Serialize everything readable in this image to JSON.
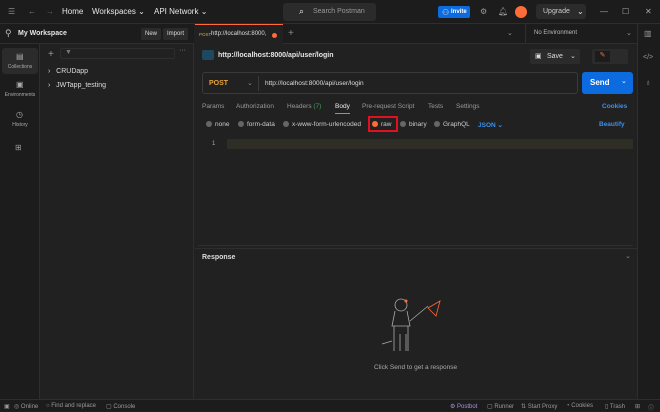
{
  "topbar": {
    "home": "Home",
    "workspaces": "Workspaces",
    "api_network": "API Network",
    "search_placeholder": "Search Postman",
    "invite": "Invite",
    "upgrade": "Upgrade"
  },
  "rail": [
    {
      "label": "Collections",
      "icon": "collections-icon"
    },
    {
      "label": "Environments",
      "icon": "environments-icon"
    },
    {
      "label": "History",
      "icon": "history-icon"
    }
  ],
  "sidebar": {
    "workspace": "My Workspace",
    "new": "New",
    "import": "Import",
    "collections": [
      "CRUDapp",
      "JWTapp_testing"
    ]
  },
  "tabs": {
    "method": "POST",
    "title": "http://localhost:8000,",
    "environment": "No Environment"
  },
  "request": {
    "title": "http://localhost:8000/api/user/login",
    "save": "Save",
    "method": "POST",
    "url": "http://localhost:8000/api/user/login",
    "send": "Send",
    "tabs": [
      "Params",
      "Authorization",
      "Headers",
      "Body",
      "Pre-request Script",
      "Tests",
      "Settings"
    ],
    "headers_count": "(7)",
    "cookies": "Cookies",
    "body_options": [
      "none",
      "form-data",
      "x-www-form-urlencoded",
      "raw",
      "binary",
      "GraphQL"
    ],
    "format": "JSON",
    "beautify": "Beautify",
    "line": "1"
  },
  "response": {
    "title": "Response",
    "hint": "Click Send to get a response"
  },
  "statusbar": {
    "left": [
      "Online",
      "Find and replace",
      "Console"
    ],
    "right": [
      "Postbot",
      "Runner",
      "Start Proxy",
      "Cookies",
      "Trash"
    ]
  },
  "colors": {
    "accent": "#ff6c37",
    "blue": "#0c6bde",
    "post": "#e8a33d"
  }
}
